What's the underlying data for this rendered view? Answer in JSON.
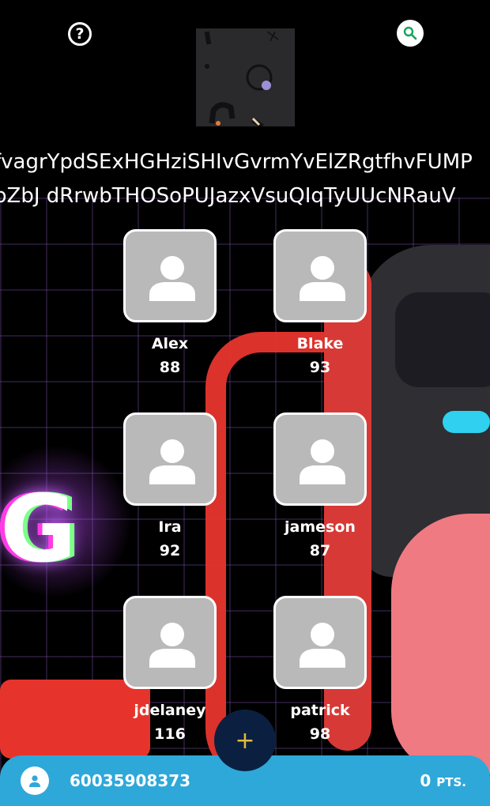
{
  "header": {
    "help_icon": "question-circle-icon",
    "search_icon": "search-icon",
    "ticker_line1": "fvagrYpdSExHGHziSHIvGvrmYvElZRgtfhvFUMP",
    "ticker_line2": "pZbJ dRrwbTHOSoPUJazxVsuQIqTyUUcNRauV"
  },
  "players": [
    {
      "name": "Alex",
      "score": "88"
    },
    {
      "name": "Blake",
      "score": "93"
    },
    {
      "name": "Ira",
      "score": "92"
    },
    {
      "name": "jameson",
      "score": "87"
    },
    {
      "name": "jdelaney",
      "score": "116"
    },
    {
      "name": "patrick",
      "score": "98"
    }
  ],
  "fab": {
    "label": "+"
  },
  "footer": {
    "phone": "60035908373",
    "points_value": "0",
    "points_unit": "PTS."
  },
  "colors": {
    "footer_bg": "#2ea8d9",
    "fab_bg": "#0b2040",
    "fab_plus": "#e5b93b",
    "avatar_bg": "#b9b9b9"
  }
}
